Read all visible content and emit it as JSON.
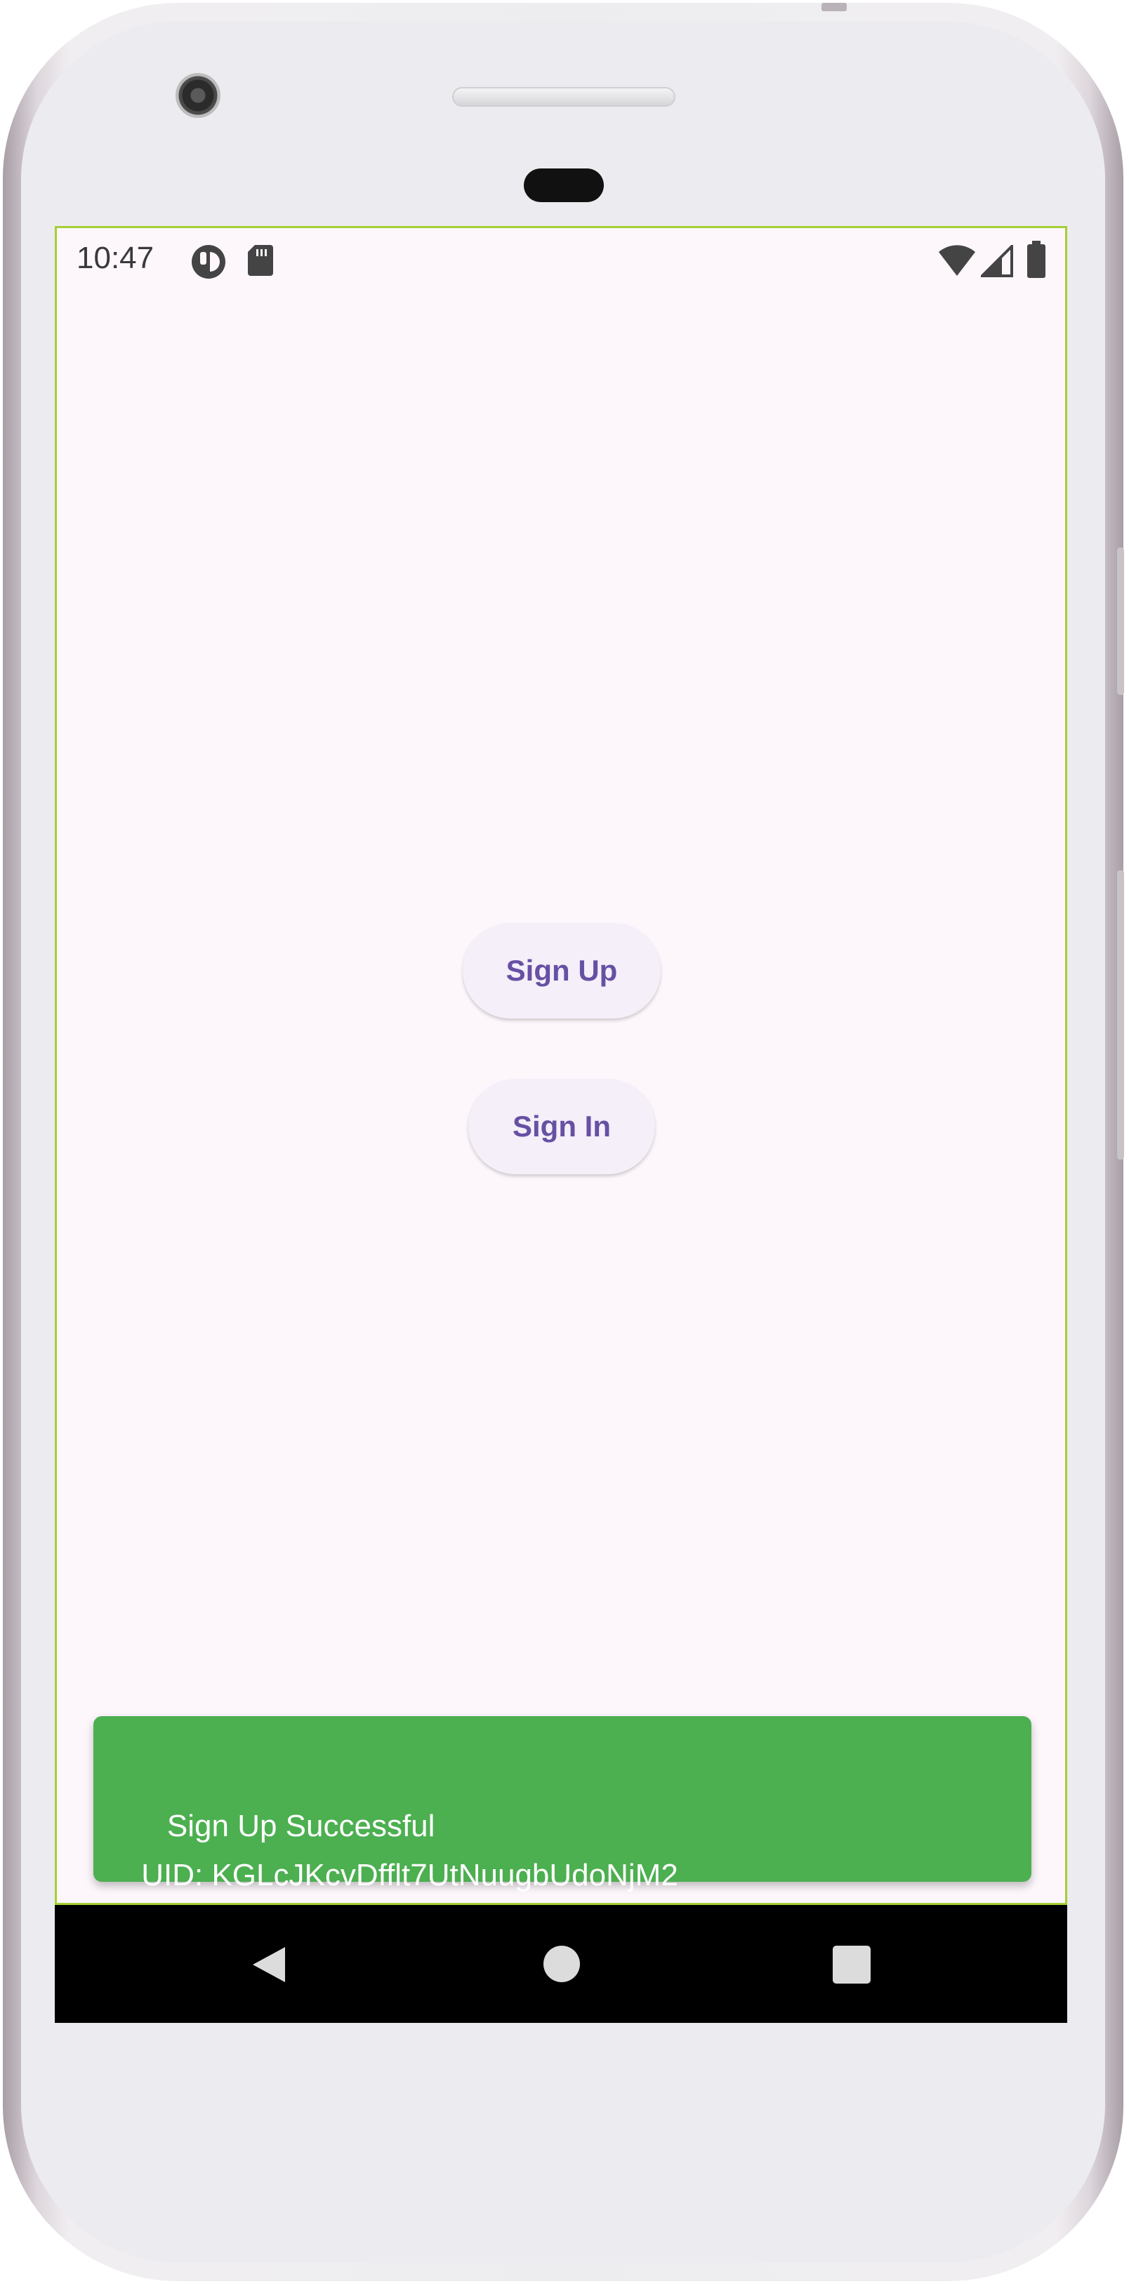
{
  "status_bar": {
    "time": "10:47",
    "left_icons": [
      "app-notification-icon",
      "sd-card-icon"
    ],
    "right_icons": [
      "wifi-icon",
      "cell-signal-icon",
      "battery-icon"
    ]
  },
  "main": {
    "sign_up_label": "Sign Up",
    "sign_in_label": "Sign In"
  },
  "snackbar": {
    "message": "Sign Up Successful\n UID: KGLcJKcvDfflt7UtNuugbUdoNjM2",
    "background_color": "#4caf50"
  },
  "nav_bar": {
    "icons": [
      "back-icon",
      "home-icon",
      "recents-icon"
    ]
  },
  "colors": {
    "screen_bg": "#fdf7fc",
    "button_text": "#6750a4",
    "button_bg": "#f4eff8",
    "screen_border": "#a5cf33"
  }
}
